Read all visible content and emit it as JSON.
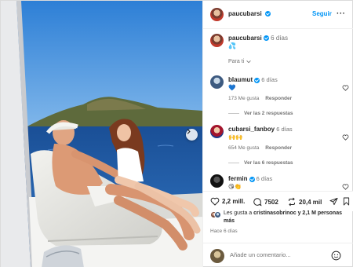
{
  "header": {
    "username": "paucubarsi",
    "follow_label": "Seguir",
    "more_label": "···"
  },
  "caption": {
    "username": "paucubarsi",
    "time": "6 días",
    "text": "💦",
    "para_ti": "Para ti"
  },
  "comments": [
    {
      "username": "blaumut",
      "time": "6 días",
      "text": "💙",
      "likes": "173 Me gusta",
      "reply": "Responder",
      "view_replies": "Ver las 2 respuestas"
    },
    {
      "username": "cubarsi_fanboy",
      "time": "6 días",
      "text": "🙌🙌",
      "likes": "654 Me gusta",
      "reply": "Responder",
      "view_replies": "Ver las 6 respuestas"
    },
    {
      "username": "fermin",
      "time": "6 días",
      "text": "😘👏"
    }
  ],
  "actions": {
    "likes_count": "2,2 mill.",
    "comments_count": "7502",
    "reposts_count": "20,4 mil"
  },
  "liked_by": {
    "prefix": "Les gusta a",
    "user": "cristinasobrinoc",
    "suffix": "y 2,1 M personas más"
  },
  "posted": "Hace 6 días",
  "add_comment": {
    "placeholder": "Añade un comentario..."
  },
  "colors": {
    "link": "#0095f6",
    "text": "#262626",
    "muted": "#737373",
    "sea": "#1f5fae",
    "sky": "#3d8fe0"
  },
  "icons": [
    "heart-icon",
    "comment-icon",
    "repost-icon",
    "share-icon",
    "bookmark-icon",
    "emoji-icon",
    "chevron-right-icon",
    "chevron-down-icon",
    "verified-icon"
  ]
}
